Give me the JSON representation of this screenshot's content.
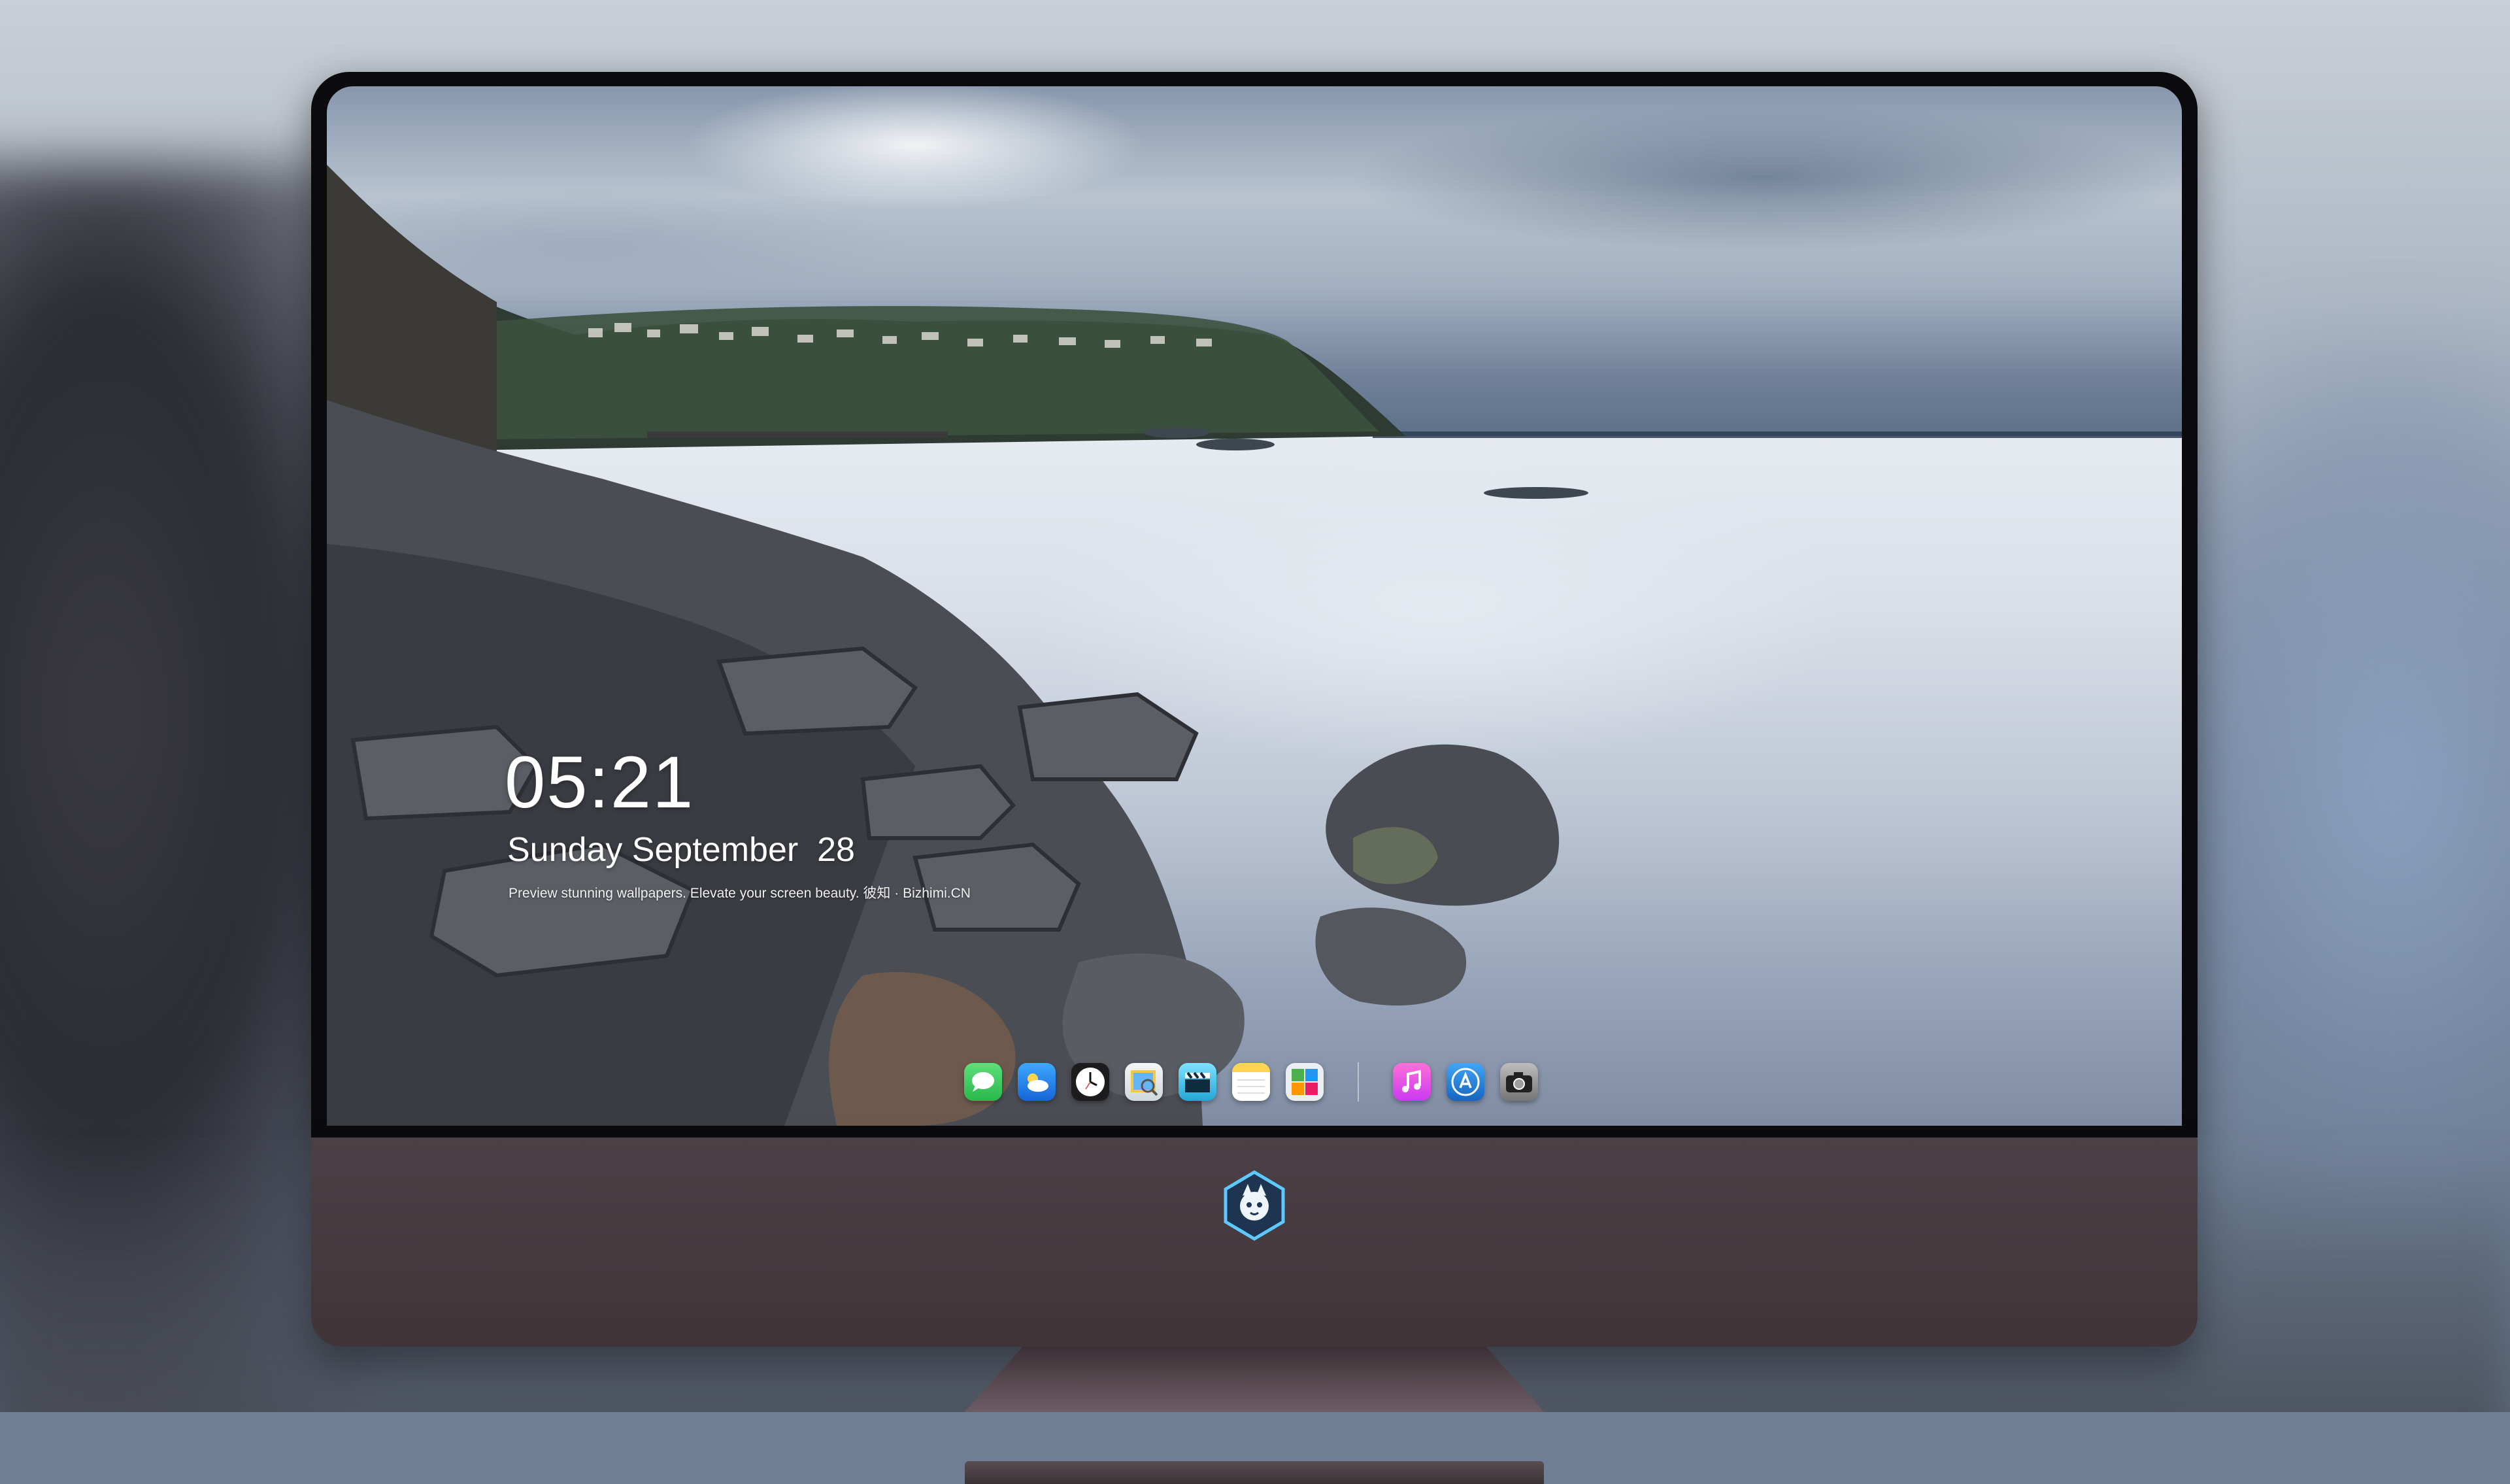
{
  "lockscreen": {
    "time": "05:21",
    "date": "Sunday September  28",
    "tagline": "Preview stunning wallpapers. Elevate your screen beauty. 彼知 · Bizhimi.CN"
  },
  "dock": {
    "apps": [
      {
        "name": "messages-icon",
        "color": "#34c759"
      },
      {
        "name": "weather-icon",
        "color": "#1e90ff"
      },
      {
        "name": "clock-icon",
        "color": "#ffffff"
      },
      {
        "name": "preview-icon",
        "color": "#f2c94c"
      },
      {
        "name": "claquette-icon",
        "color": "#40c4ff"
      },
      {
        "name": "notes-icon",
        "color": "#ffd54f"
      },
      {
        "name": "photo-booth-icon",
        "color": "#e0e0e0"
      },
      {
        "name": "music-icon",
        "color": "#f06292"
      },
      {
        "name": "app-store-icon",
        "color": "#2196f3"
      },
      {
        "name": "camera-icon",
        "color": "#9e9e9e"
      }
    ]
  },
  "colors": {
    "chin": "#473c41",
    "bezel": "#0b0b0d",
    "sea": "#d9dfe8"
  }
}
